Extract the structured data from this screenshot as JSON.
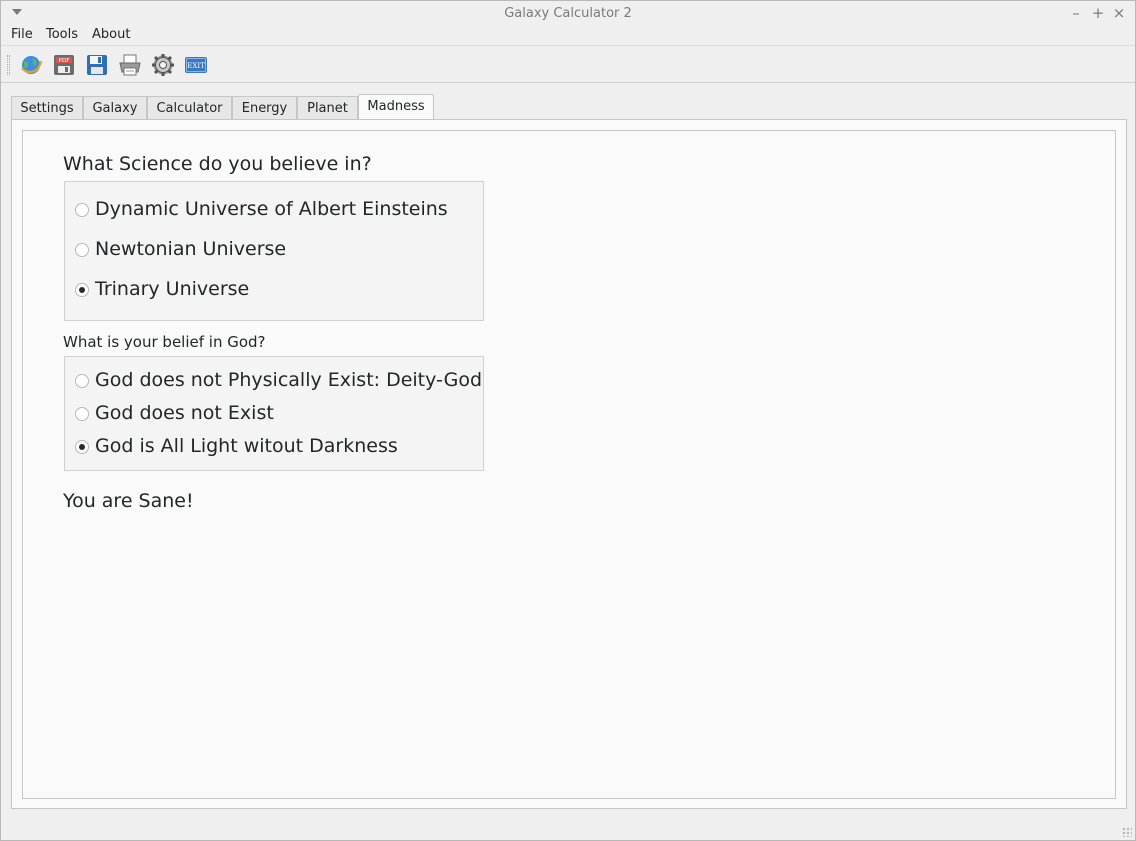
{
  "window": {
    "title": "Galaxy Calculator 2",
    "minimize_glyph": "–",
    "maximize_glyph": "+",
    "close_glyph": "×"
  },
  "menubar": {
    "items": [
      "File",
      "Tools",
      "About"
    ]
  },
  "toolbar": {
    "icons": [
      "globe-icon",
      "pdf-icon",
      "save-icon",
      "save-as-icon",
      "print-icon",
      "settings-gear-icon",
      "exit-icon"
    ],
    "pdf_text": "PDF",
    "exit_text": "EXIT"
  },
  "tabs": {
    "items": [
      "Settings",
      "Galaxy",
      "Calculator",
      "Energy",
      "Planet",
      "Madness"
    ],
    "active": "Madness"
  },
  "madness": {
    "science_question": "What Science do you believe in?",
    "science_options": [
      {
        "label": "Dynamic Universe of Albert Einsteins",
        "checked": false
      },
      {
        "label": "Newtonian Universe",
        "checked": false
      },
      {
        "label": "Trinary Universe",
        "checked": true
      }
    ],
    "god_question": "What is your belief in God?",
    "god_options": [
      {
        "label": "God does not Physically Exist: Deity-God",
        "checked": false
      },
      {
        "label": "God does not Exist",
        "checked": false
      },
      {
        "label": "God is All Light witout Darkness",
        "checked": true
      }
    ],
    "result": "You are Sane!"
  }
}
